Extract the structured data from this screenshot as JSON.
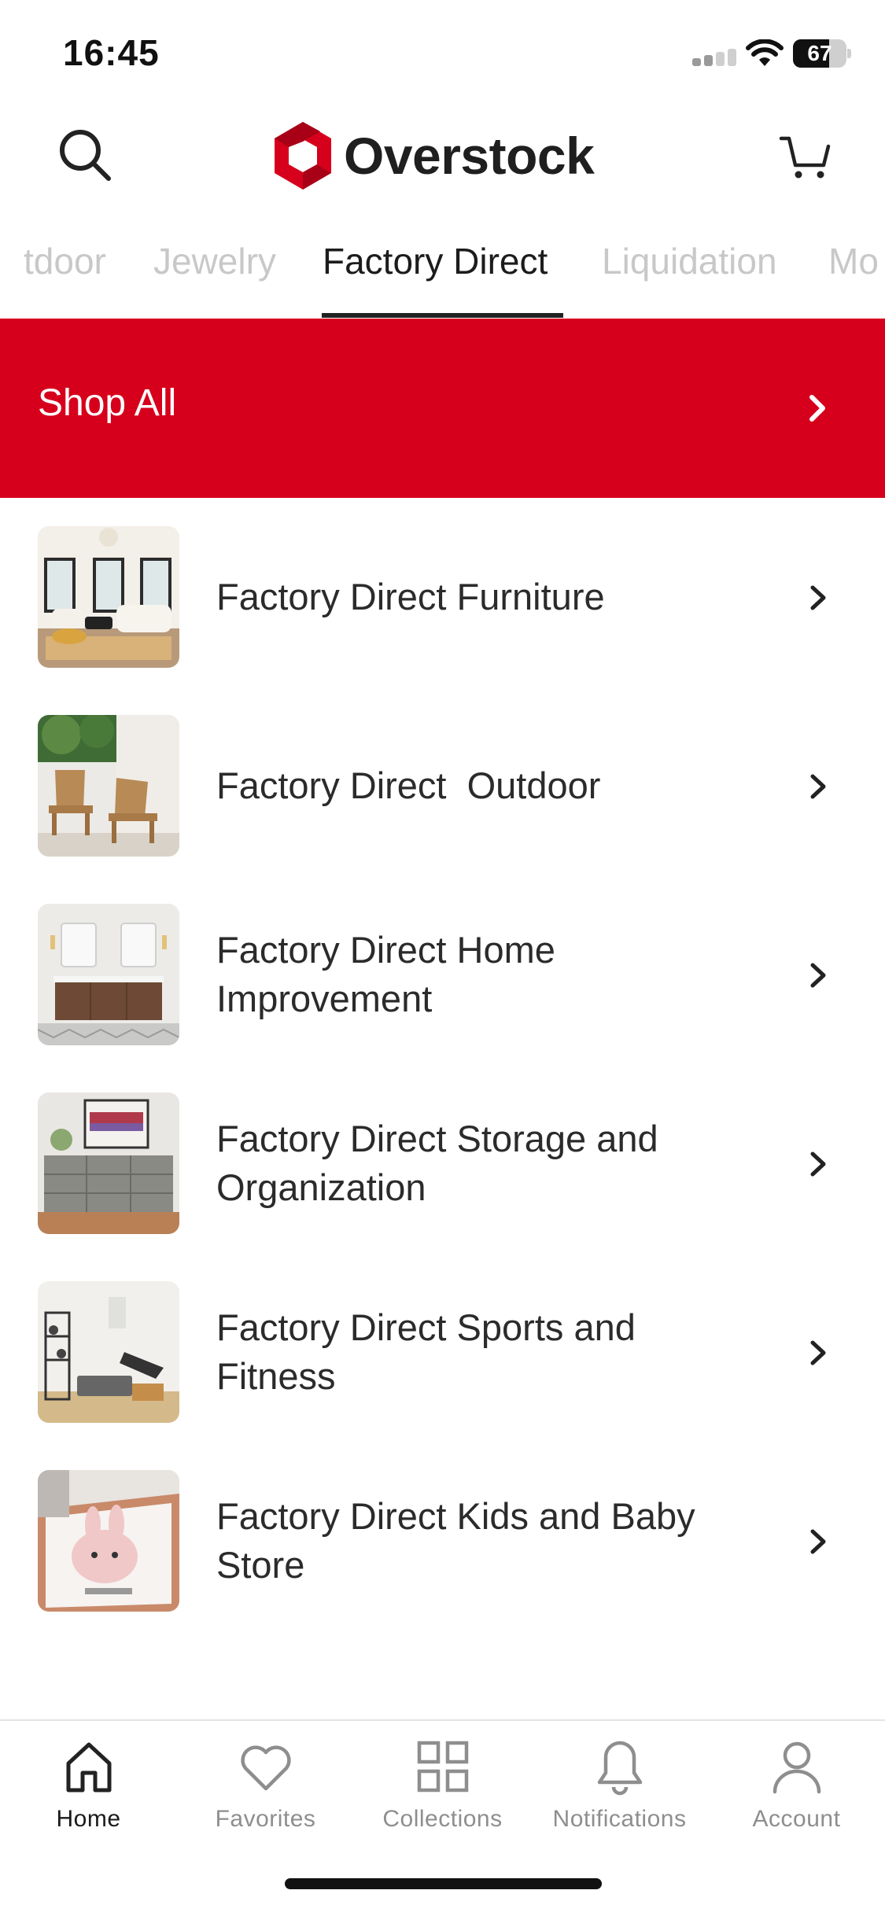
{
  "status_bar": {
    "time": "16:45",
    "battery_level": "67"
  },
  "header": {
    "brand": "Overstock",
    "brand_color": "#d6001c"
  },
  "category_tabs": [
    {
      "label": "tdoor",
      "active": false
    },
    {
      "label": "Jewelry",
      "active": false
    },
    {
      "label": "Factory Direct",
      "active": true
    },
    {
      "label": "Liquidation",
      "active": false
    },
    {
      "label": "Mo",
      "active": false
    }
  ],
  "shop_all": {
    "label": "Shop All"
  },
  "items": [
    {
      "label": "Factory Direct Furniture",
      "thumb": "living-room-image"
    },
    {
      "label": "Factory Direct  Outdoor",
      "thumb": "adirondack-chairs-image"
    },
    {
      "label": "Factory Direct Home\nImprovement",
      "thumb": "bathroom-vanity-image"
    },
    {
      "label": "Factory Direct Storage and\nOrganization",
      "thumb": "dresser-image"
    },
    {
      "label": "Factory Direct Sports and\nFitness",
      "thumb": "home-gym-image"
    },
    {
      "label": "Factory Direct Kids and Baby\nStore",
      "thumb": "kids-rug-image"
    }
  ],
  "tab_bar": [
    {
      "label": "Home",
      "icon": "home-icon",
      "active": true
    },
    {
      "label": "Favorites",
      "icon": "heart-icon",
      "active": false
    },
    {
      "label": "Collections",
      "icon": "grid-icon",
      "active": false
    },
    {
      "label": "Notifications",
      "icon": "bell-icon",
      "active": false
    },
    {
      "label": "Account",
      "icon": "person-icon",
      "active": false
    }
  ]
}
